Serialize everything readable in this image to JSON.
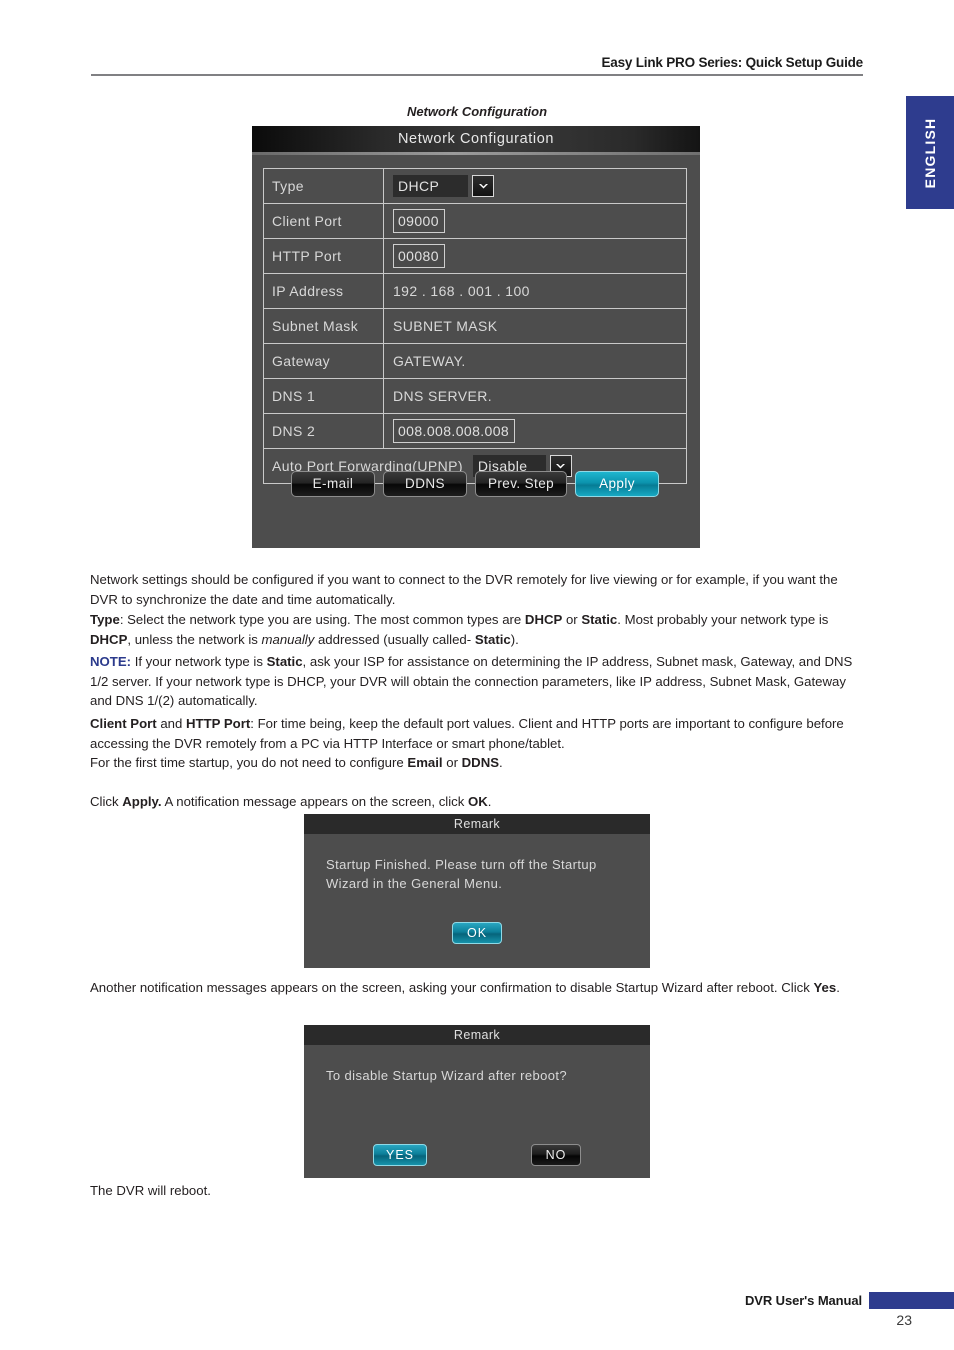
{
  "header": {
    "title": "Easy Link PRO Series: Quick Setup Guide"
  },
  "side_tab": {
    "label": "ENGLISH"
  },
  "figure_caption": "Network Configuration",
  "network_panel": {
    "title": "Network Configuration",
    "rows": [
      {
        "label": "Type",
        "value": "DHCP",
        "kind": "select"
      },
      {
        "label": "Client Port",
        "value": "09000",
        "kind": "input"
      },
      {
        "label": "HTTP Port",
        "value": "00080",
        "kind": "input"
      },
      {
        "label": "IP Address",
        "value": "192 . 168 . 001 . 100",
        "kind": "text"
      },
      {
        "label": "Subnet Mask",
        "value": "SUBNET MASK",
        "kind": "text"
      },
      {
        "label": "Gateway",
        "value": "GATEWAY.",
        "kind": "text"
      },
      {
        "label": "DNS 1",
        "value": "DNS SERVER.",
        "kind": "text"
      },
      {
        "label": "DNS 2",
        "value": "008.008.008.008",
        "kind": "input"
      }
    ],
    "upnp": {
      "label": "Auto Port Forwarding(UPNP)",
      "value": "Disable"
    },
    "buttons": {
      "email": "E-mail",
      "ddns": "DDNS",
      "prev_step": "Prev. Step",
      "apply": "Apply"
    }
  },
  "remark_ok": {
    "title": "Remark",
    "message": "Startup Finished. Please turn off the Startup Wizard in the General Menu.",
    "ok_label": "OK"
  },
  "remark_yesno": {
    "title": "Remark",
    "message": "To disable Startup Wizard after reboot?",
    "yes_label": "YES",
    "no_label": "NO"
  },
  "body": {
    "p1_a": "Network settings should be configured if you want to connect to the DVR remotely for live viewing or for example, if you want the DVR to synchronize the date and time automatically.",
    "p2_lead": "Type",
    "p2_a": ": Select the network type you are using. The most common types are ",
    "p2_b1": "DHCP",
    "p2_b": " or ",
    "p2_b2": "Static",
    "p2_c": ". Most probably your network type is ",
    "p2_b3": "DHCP",
    "p2_d": ", unless the network is ",
    "p2_i": "manually",
    "p2_e": " addressed (usually called- ",
    "p2_b4": "Static",
    "p2_f": ").",
    "p3_note": "NOTE:",
    "p3_a": " If your network type is ",
    "p3_b1": "Static",
    "p3_b": ", ask your ISP for assistance on determining the IP address, Subnet mask, Gateway, and DNS 1/2 server. If your network type is DHCP, your DVR will obtain the connection parameters, like IP address, Subnet Mask, Gateway and DNS 1/(2) automatically.",
    "p4_b1": "Client Port",
    "p4_a": " and ",
    "p4_b2": "HTTP Port",
    "p4_b": ": For time being, keep the default port values. Client and HTTP ports are important to configure before accessing the DVR remotely from a PC via HTTP Interface or smart phone/tablet.",
    "p4_c": "For the first time startup, you do not need to configure ",
    "p4_b3": "Email",
    "p4_d": " or ",
    "p4_b4": "DDNS",
    "p4_e": ".",
    "p5_a": "Click ",
    "p5_b1": "Apply.",
    "p5_b": " A notification message appears on the screen, click ",
    "p5_b2": "OK",
    "p5_c": ".",
    "p6_a": "Another notification messages appears on the screen, asking your confirmation to disable Startup Wizard after reboot. Click ",
    "p6_b1": "Yes",
    "p6_b": ".",
    "p7_a": "The DVR will reboot."
  },
  "footer": {
    "label": "DVR User's Manual",
    "page": "23"
  },
  "colors": {
    "brand_blue": "#2e3c8e",
    "note_blue": "#2b3a8c",
    "panel_bg": "#4d4d4d",
    "accent_cyan": "#0b93ad"
  }
}
